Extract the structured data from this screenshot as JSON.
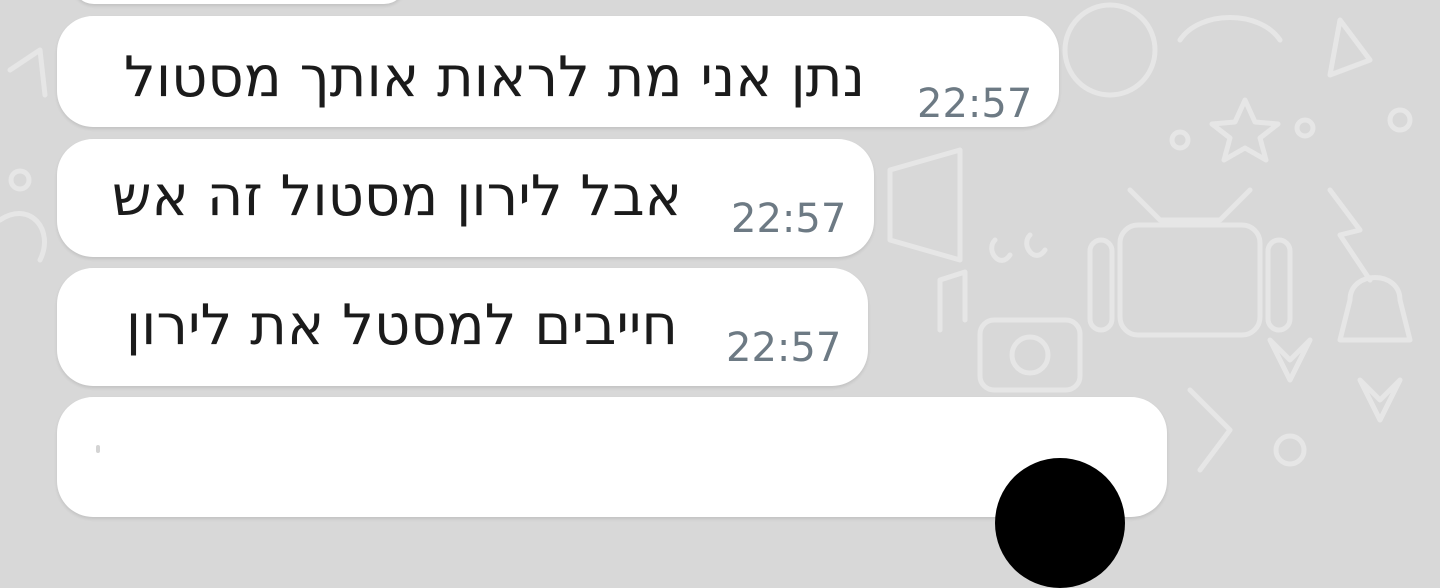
{
  "chat": {
    "messages": [
      {
        "text": "נתן אני מת לראות אותך מסטול",
        "time": "22:57"
      },
      {
        "text": "אבל לירון מסטול זה אש",
        "time": "22:57"
      },
      {
        "text": "חייבים למסטל את לירון",
        "time": "22:57"
      }
    ],
    "media_message": {
      "avatar_icon": "avatar"
    }
  },
  "colors": {
    "wallpaper": "#d8d8d8",
    "wallpaper_doodle": "#e6e6e6",
    "bubble": "#ffffff",
    "message_text": "#1b1b1b",
    "timestamp": "#6d7a84"
  }
}
